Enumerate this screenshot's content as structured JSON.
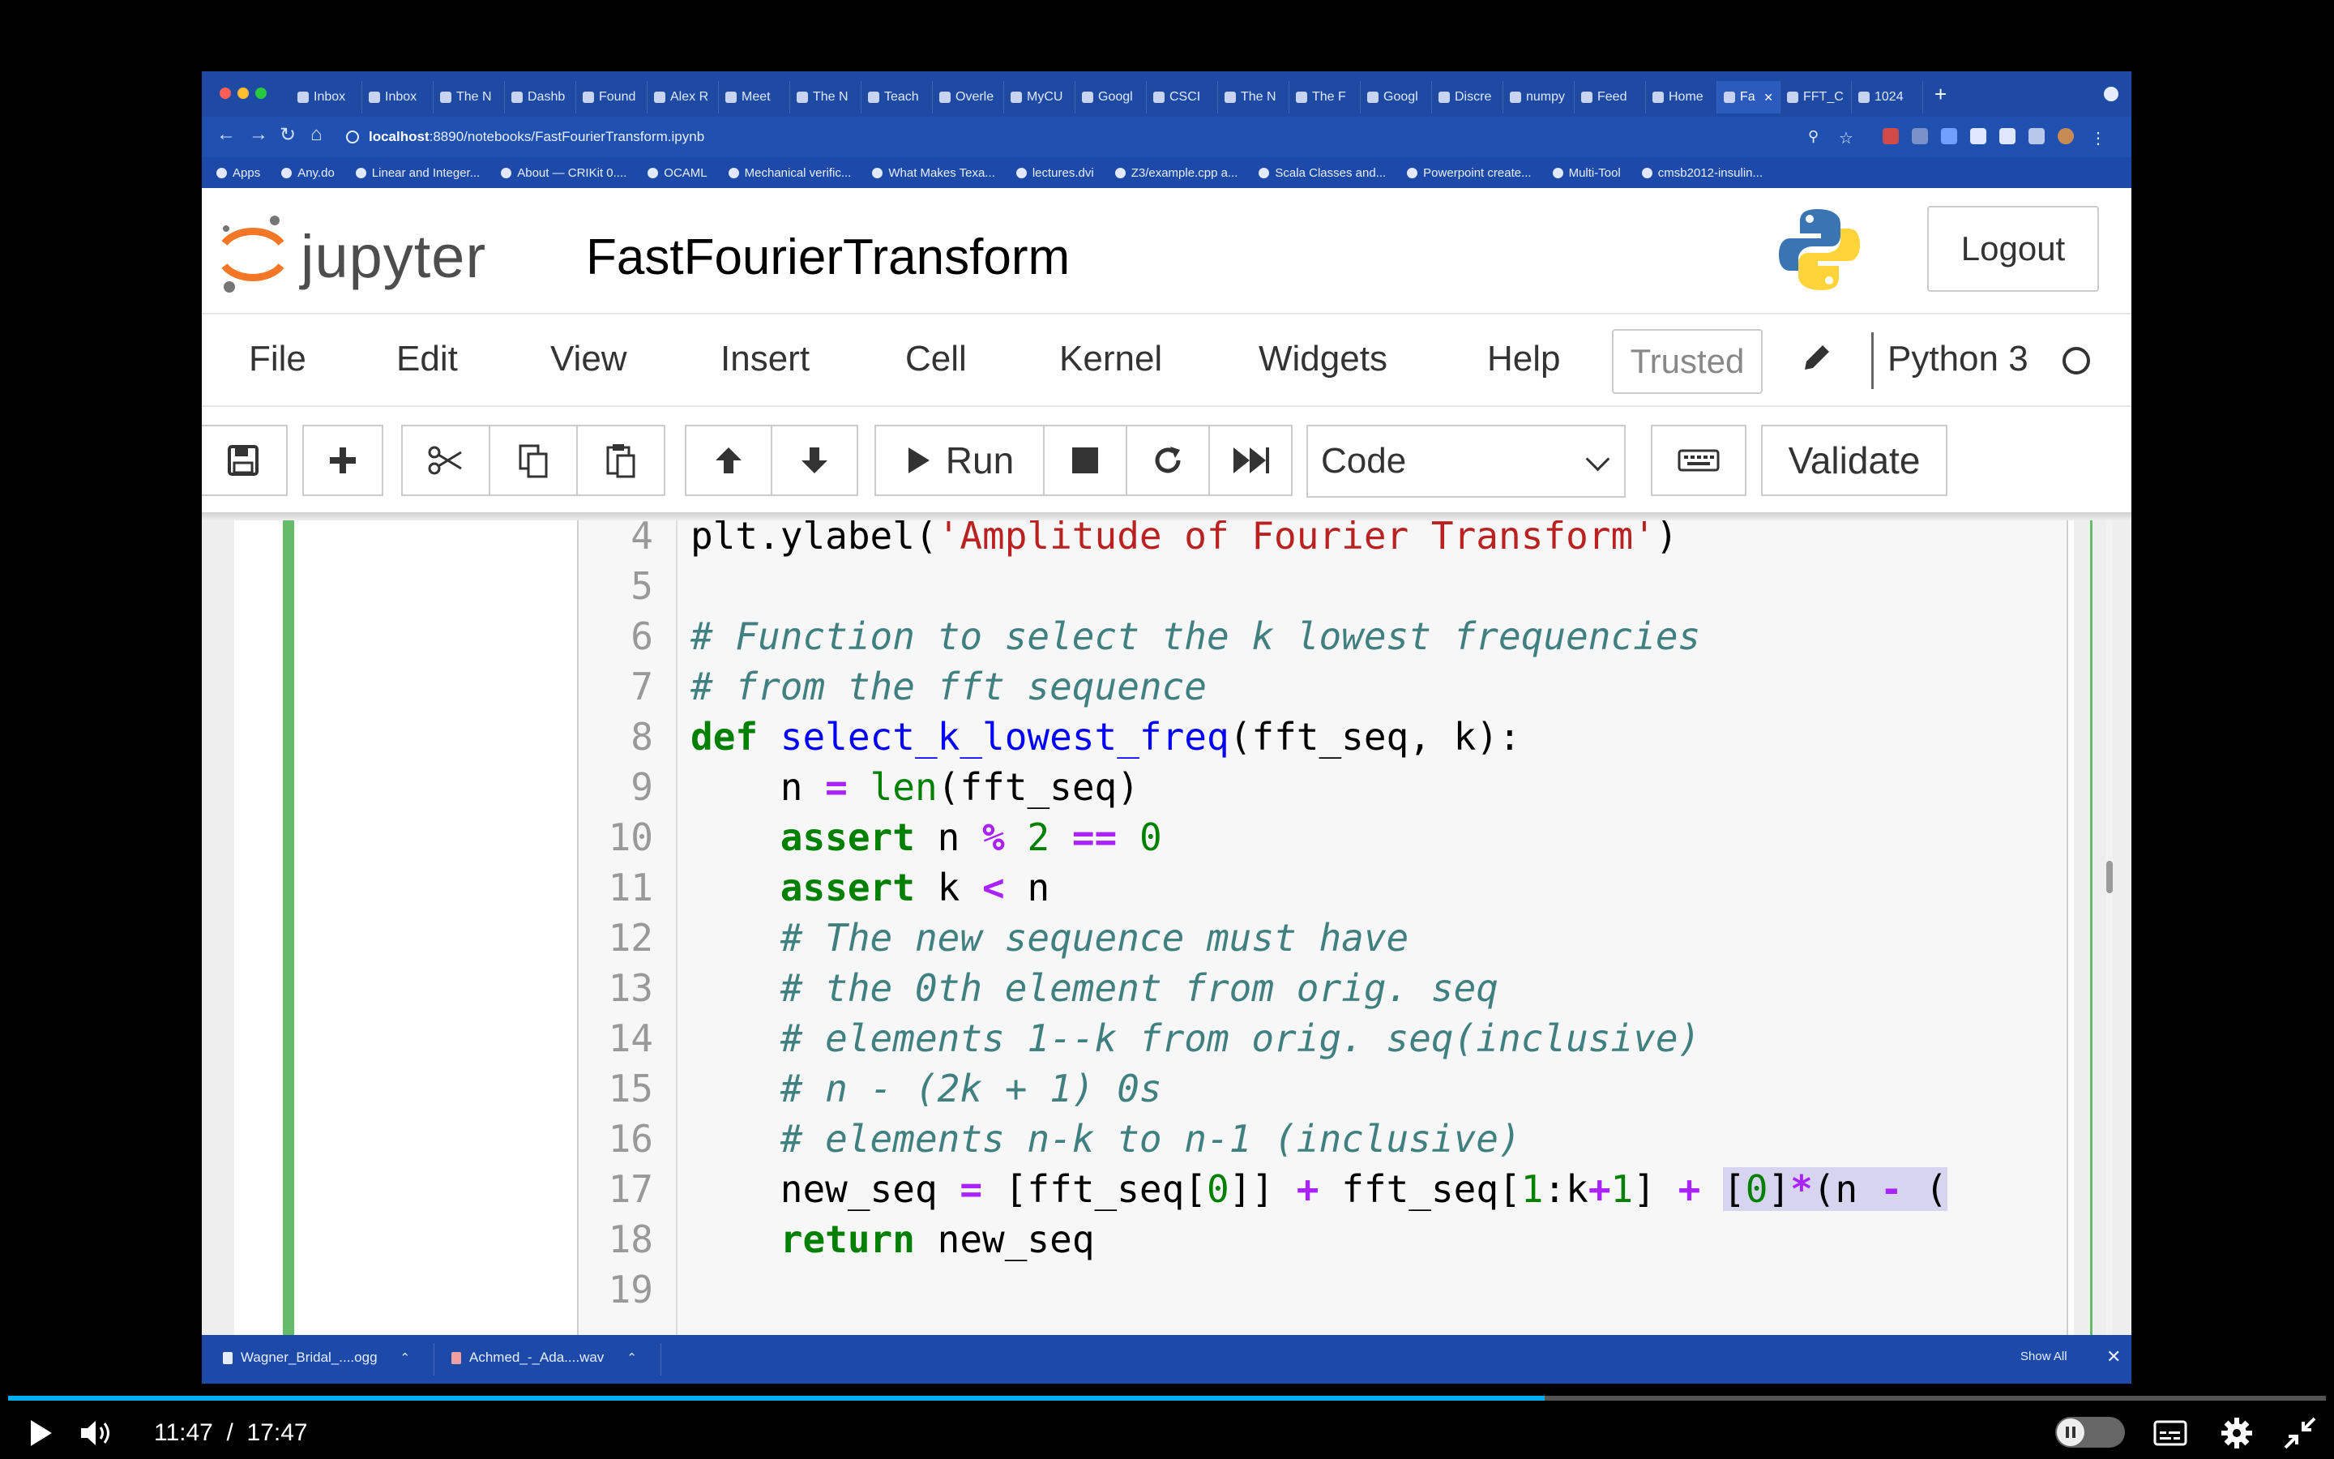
{
  "browser": {
    "tabs": [
      {
        "label": "Inbox",
        "active": false
      },
      {
        "label": "Inbox",
        "active": false
      },
      {
        "label": "The N",
        "active": false
      },
      {
        "label": "Dashb",
        "active": false
      },
      {
        "label": "Found",
        "active": false
      },
      {
        "label": "Alex R",
        "active": false
      },
      {
        "label": "Meet",
        "active": false
      },
      {
        "label": "The N",
        "active": false
      },
      {
        "label": "Teach",
        "active": false
      },
      {
        "label": "Overle",
        "active": false
      },
      {
        "label": "MyCU",
        "active": false
      },
      {
        "label": "Googl",
        "active": false
      },
      {
        "label": "CSCI",
        "active": false
      },
      {
        "label": "The N",
        "active": false
      },
      {
        "label": "The F",
        "active": false
      },
      {
        "label": "Googl",
        "active": false
      },
      {
        "label": "Discre",
        "active": false
      },
      {
        "label": "numpy",
        "active": false
      },
      {
        "label": "Feed",
        "active": false
      },
      {
        "label": "Home",
        "active": false
      },
      {
        "label": "Fa",
        "active": true
      },
      {
        "label": "FFT_C",
        "active": false
      },
      {
        "label": "1024",
        "active": false
      }
    ],
    "url_host": "localhost",
    "url_rest": ":8890/notebooks/FastFourierTransform.ipynb",
    "bookmarks": [
      "Apps",
      "Any.do",
      "Linear and Integer...",
      "About — CRIKit 0....",
      "OCAML",
      "Mechanical verific...",
      "What Makes Texa...",
      "lectures.dvi",
      "Z3/example.cpp a...",
      "Scala Classes and...",
      "Powerpoint create...",
      "Multi-Tool",
      "cmsb2012-insulin..."
    ]
  },
  "jupyter": {
    "wordmark": "jupyter",
    "notebook_title": "FastFourierTransform",
    "logout_label": "Logout",
    "menu": [
      "File",
      "Edit",
      "View",
      "Insert",
      "Cell",
      "Kernel",
      "Widgets",
      "Help"
    ],
    "trusted_label": "Trusted",
    "kernel_name": "Python 3",
    "run_label": "Run",
    "cell_type": "Code",
    "validate_label": "Validate",
    "code_lines": [
      {
        "n": "4",
        "text": "plt.ylabel('Amplitude of Fourier Transform')"
      },
      {
        "n": "5",
        "text": ""
      },
      {
        "n": "6",
        "text": "# Function to select the k lowest frequencies"
      },
      {
        "n": "7",
        "text": "# from the fft sequence"
      },
      {
        "n": "8",
        "text": "def select_k_lowest_freq(fft_seq, k):"
      },
      {
        "n": "9",
        "text": "    n = len(fft_seq)"
      },
      {
        "n": "10",
        "text": "    assert n % 2 == 0"
      },
      {
        "n": "11",
        "text": "    assert k < n"
      },
      {
        "n": "12",
        "text": "    # The new sequence must have"
      },
      {
        "n": "13",
        "text": "    # the 0th element from orig. seq"
      },
      {
        "n": "14",
        "text": "    # elements 1--k from orig. seq(inclusive)"
      },
      {
        "n": "15",
        "text": "    # n - (2k + 1) 0s"
      },
      {
        "n": "16",
        "text": "    # elements n-k to n-1 (inclusive)"
      },
      {
        "n": "17",
        "text": "    new_seq = [fft_seq[0]] + fft_seq[1:k+1] + [0]*(n - ("
      },
      {
        "n": "18",
        "text": "    return new_seq"
      },
      {
        "n": "19",
        "text": ""
      }
    ]
  },
  "downloads": [
    {
      "name": "Wagner_Bridal_....ogg"
    },
    {
      "name": "Achmed_-_Ada....wav"
    }
  ],
  "downloads_show_all": "Show All",
  "player": {
    "current_time": "11:47",
    "separator": "/",
    "duration": "17:47",
    "progress": 0.663
  },
  "colors": {
    "accent_progress": "#00adef",
    "cell_selected": "#66bb6a",
    "chrome_blue": "#1f4aa3"
  }
}
